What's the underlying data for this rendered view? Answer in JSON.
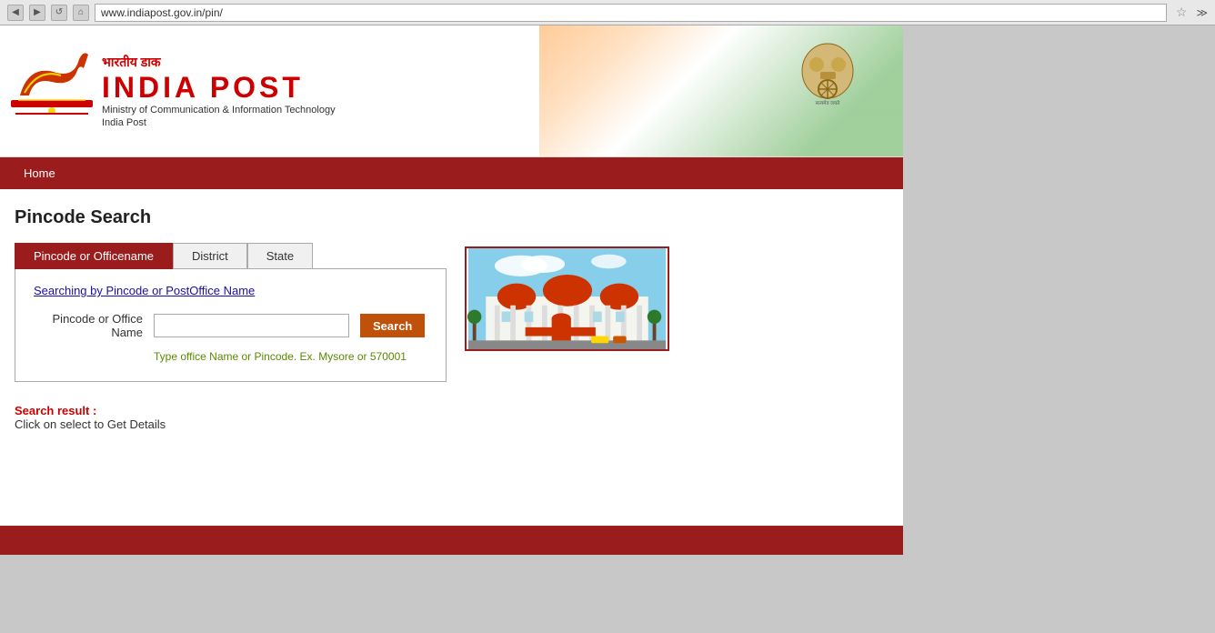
{
  "browser": {
    "url": "www.indiapost.gov.in/pin/",
    "back_btn": "◀",
    "forward_btn": "▶",
    "refresh_btn": "↺",
    "home_btn": "⌂"
  },
  "header": {
    "hindi_text": "भारतीय डाक",
    "english_title": "INDIA POST",
    "ministry_text": "Ministry of Communication & Information Technology",
    "india_post_label": "India Post",
    "emblem_unicode": "🦁",
    "emblem_tagline": "सत्यमेव जयते"
  },
  "nav": {
    "home_label": "Home"
  },
  "page": {
    "title": "Pincode Search"
  },
  "tabs": [
    {
      "id": "pincode-tab",
      "label": "Pincode or Officename",
      "active": true
    },
    {
      "id": "district-tab",
      "label": "District",
      "active": false
    },
    {
      "id": "state-tab",
      "label": "State",
      "active": false
    }
  ],
  "search_form": {
    "link_text": "Searching by Pincode or PostOffice Name",
    "label": "Pincode or Office Name",
    "input_value": "",
    "input_placeholder": "",
    "search_button": "Search",
    "hint_text": "Type office Name or Pincode. Ex. Mysore or 570001"
  },
  "search_result": {
    "title": "Search result :",
    "subtitle": "Click on select to Get Details"
  },
  "footer": {}
}
